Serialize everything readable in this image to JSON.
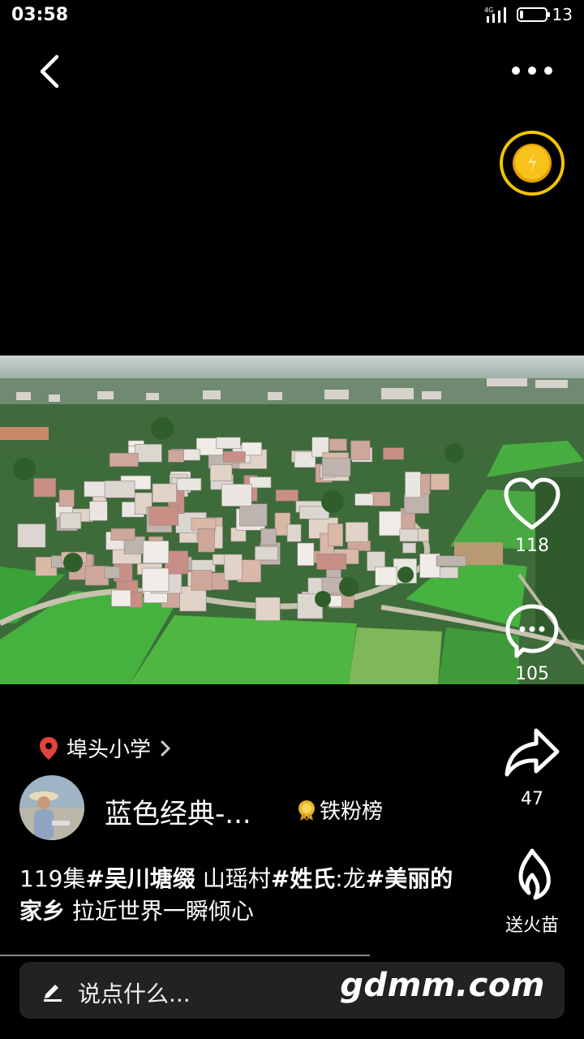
{
  "status_bar": {
    "time": "03:58",
    "network": "4G",
    "battery": "13",
    "battery_level": 0.13
  },
  "top_bar": {
    "back_icon": "chevron-left-icon",
    "more_icon": "more-dots-icon",
    "coin_icon": "gold-coin-icon"
  },
  "actions": {
    "like": {
      "icon": "heart-outline-icon",
      "count": "118"
    },
    "comment": {
      "icon": "comment-bubble-icon",
      "count": "105"
    },
    "share": {
      "icon": "share-arrow-icon",
      "count": "47"
    },
    "gift": {
      "icon": "flame-icon",
      "label": "送火苗"
    }
  },
  "location": {
    "icon": "location-pin-icon",
    "name": "埠头小学",
    "chevron": "chevron-right-icon"
  },
  "author": {
    "name": "蓝色经典-...",
    "badge_label": "铁粉榜"
  },
  "caption": {
    "part1": "119集",
    "tag1": "#吴川塘缀",
    "part2": " 山瑶村",
    "tag2": "#姓氏",
    "part3": ":龙",
    "tag3": "#美丽的家乡",
    "part4": " 拉近世界一瞬倾心"
  },
  "comment_bar": {
    "placeholder": "说点什么...",
    "watermark": "gdmm.com"
  },
  "colors": {
    "accent_gold": "#F2C500",
    "pin_red": "#E0443C",
    "background": "#000000"
  }
}
